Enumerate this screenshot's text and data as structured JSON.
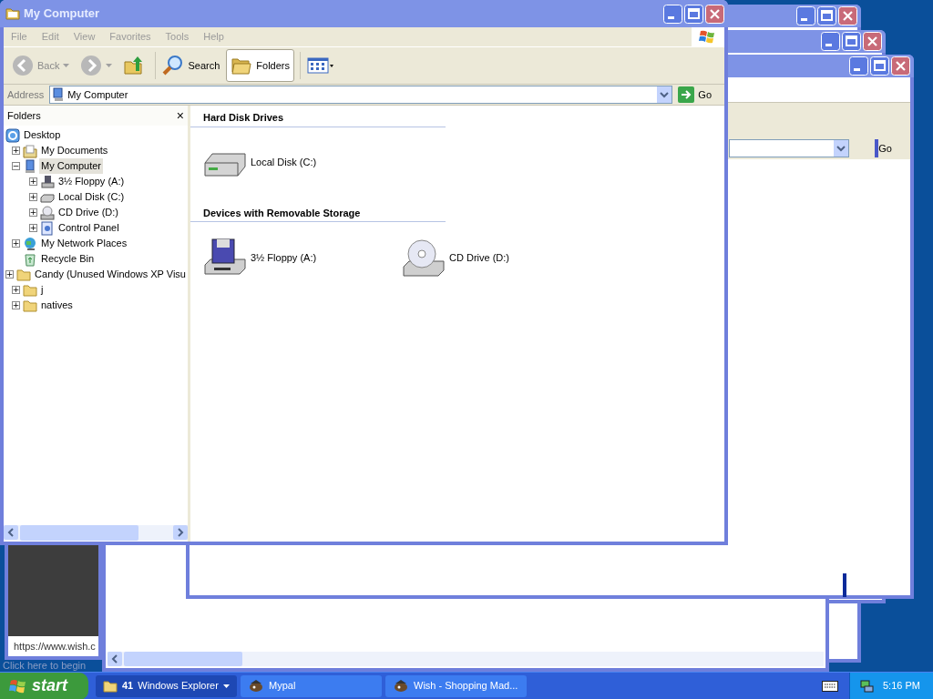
{
  "background": {
    "go": "Go",
    "status_url": "https://www.wish.c",
    "start_hint": "Click here to begin"
  },
  "window": {
    "title": "My Computer"
  },
  "menu": [
    "File",
    "Edit",
    "View",
    "Favorites",
    "Tools",
    "Help"
  ],
  "toolbar": [
    {
      "kind": "back",
      "label": "Back",
      "selected": false
    },
    {
      "kind": "forward",
      "selected": false
    },
    {
      "kind": "up",
      "selected": false
    },
    {
      "kind": "search",
      "label": "Search",
      "selected": false
    },
    {
      "kind": "folders",
      "label": "Folders",
      "selected": true
    },
    {
      "kind": "views",
      "selected": false
    }
  ],
  "address": {
    "label": "Address",
    "value": "My Computer",
    "go": "Go"
  },
  "folders_pane": {
    "title": "Folders",
    "close": "×"
  },
  "tree": [
    {
      "label": "Desktop",
      "kind": "desktop",
      "selected": false,
      "children": [
        {
          "label": "My Documents",
          "kind": "documents",
          "toggle": "+",
          "selected": false
        },
        {
          "label": "My Computer",
          "kind": "computer",
          "toggle": "−",
          "selected": true,
          "children": [
            {
              "label": "3½ Floppy (A:)",
              "kind": "floppy",
              "toggle": "+",
              "selected": false
            },
            {
              "label": "Local Disk (C:)",
              "kind": "hdd",
              "toggle": "+",
              "selected": false
            },
            {
              "label": "CD Drive (D:)",
              "kind": "cd",
              "toggle": "+",
              "selected": false
            },
            {
              "label": "Control Panel",
              "kind": "control",
              "toggle": "+",
              "selected": false
            }
          ]
        },
        {
          "label": "My Network Places",
          "kind": "network",
          "toggle": "+",
          "selected": false
        },
        {
          "label": "Recycle Bin",
          "kind": "recycle",
          "selected": false
        },
        {
          "label": "Candy (Unused Windows XP Visu",
          "kind": "folder",
          "toggle": "+",
          "selected": false
        },
        {
          "label": "j",
          "kind": "folder",
          "toggle": "+",
          "selected": false
        },
        {
          "label": "natives",
          "kind": "folder",
          "toggle": "+",
          "selected": false
        }
      ]
    }
  ],
  "groups": [
    {
      "title": "Hard Disk Drives",
      "items": [
        {
          "label": "Local Disk (C:)",
          "kind": "hdd"
        }
      ]
    },
    {
      "title": "Devices with Removable Storage",
      "items": [
        {
          "label": "3½ Floppy (A:)",
          "kind": "floppy"
        },
        {
          "label": "CD Drive (D:)",
          "kind": "cd"
        }
      ]
    }
  ],
  "taskbar": {
    "start": "start",
    "buttons": [
      {
        "kind": "folder",
        "count": "41",
        "label": "Windows Explorer",
        "selected": true
      },
      {
        "kind": "app",
        "label": "Mypal",
        "selected": false
      },
      {
        "kind": "app",
        "label": "Wish - Shopping Mad...",
        "selected": false
      }
    ],
    "clock": "5:16 PM"
  }
}
